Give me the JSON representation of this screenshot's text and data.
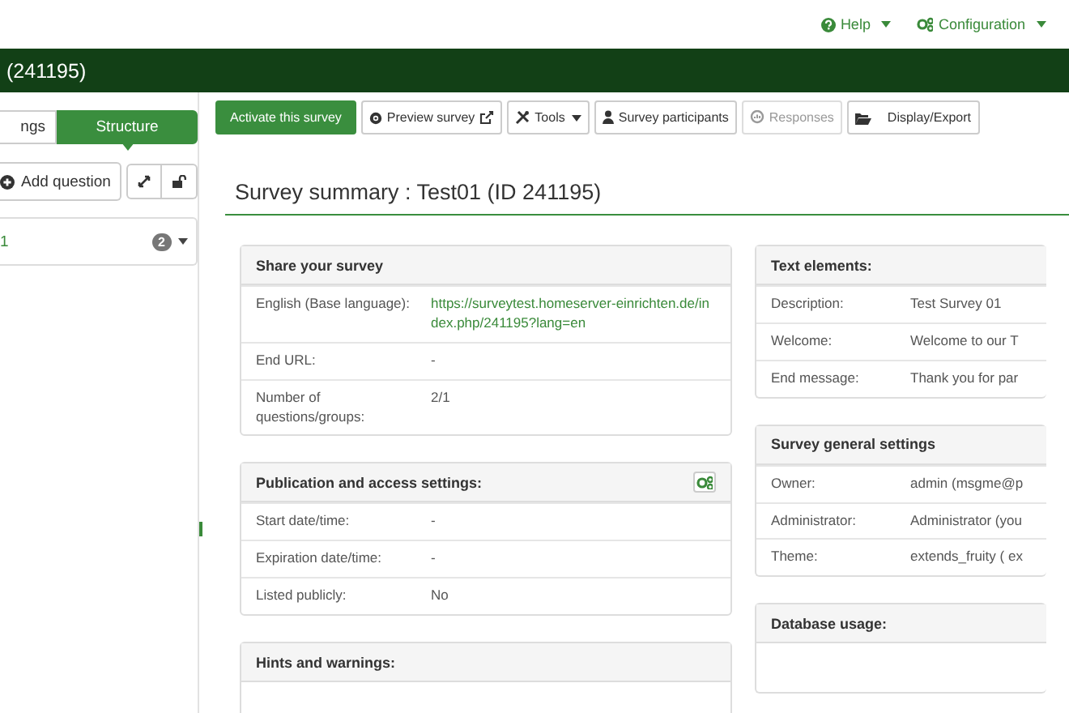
{
  "top_nav": [
    {
      "label": "Help"
    },
    {
      "label": "Configuration"
    }
  ],
  "header": {
    "title": "(241195)"
  },
  "sidebar": {
    "tabs": [
      {
        "label": "ngs",
        "selected": false
      },
      {
        "label": "Structure",
        "selected": true
      }
    ],
    "add_question": "Add question",
    "groups": [
      {
        "label": "1",
        "count": "2"
      }
    ]
  },
  "toolbar": [
    {
      "label": "Activate this survey",
      "kind": "primary",
      "disabled": false
    },
    {
      "label": "Preview survey",
      "kind": "default",
      "disabled": false
    },
    {
      "label": "Tools",
      "kind": "dropdown",
      "disabled": false
    },
    {
      "label": "Survey participants",
      "kind": "default",
      "disabled": false
    },
    {
      "label": "Responses",
      "kind": "default",
      "disabled": true
    },
    {
      "label": "Display/Export",
      "kind": "default",
      "disabled": false
    }
  ],
  "title": "Survey summary : Test01 (ID 241195)",
  "columns": [
    [
      {
        "title": "Share your survey",
        "settings_button": false,
        "rows": [
          {
            "label": "English (Base language):",
            "value": "https://surveytest.homeserver-einrichten.de/index.php/241195?lang=en",
            "link": true
          },
          {
            "label": "End URL:",
            "value": "-",
            "link": false
          },
          {
            "label": "Number of questions/groups:",
            "value": "2/1",
            "link": false
          }
        ]
      },
      {
        "title": "Publication and access settings:",
        "settings_button": true,
        "rows": [
          {
            "label": "Start date/time:",
            "value": "-",
            "link": false
          },
          {
            "label": "Expiration date/time:",
            "value": "-",
            "link": false
          },
          {
            "label": "Listed publicly:",
            "value": "No",
            "link": false
          }
        ]
      },
      {
        "title": "Hints and warnings:",
        "settings_button": false
      }
    ],
    [
      {
        "title": "Text elements:",
        "settings_button": false,
        "rows": [
          {
            "label": "Description:",
            "value": "Test Survey 01",
            "link": false
          },
          {
            "label": "Welcome:",
            "value": "Welcome to our T",
            "link": false
          },
          {
            "label": "End message:",
            "value": "Thank you for par",
            "link": false
          }
        ]
      },
      {
        "title": "Survey general settings",
        "settings_button": false,
        "rows": [
          {
            "label": "Owner:",
            "value": "admin (msgme@p",
            "link": false
          },
          {
            "label": "Administrator:",
            "value": "Administrator (you",
            "link": false
          },
          {
            "label": "Theme:",
            "value": "extends_fruity ( ex",
            "link": false
          }
        ]
      },
      {
        "title": "Database usage:",
        "settings_button": false
      }
    ]
  ]
}
